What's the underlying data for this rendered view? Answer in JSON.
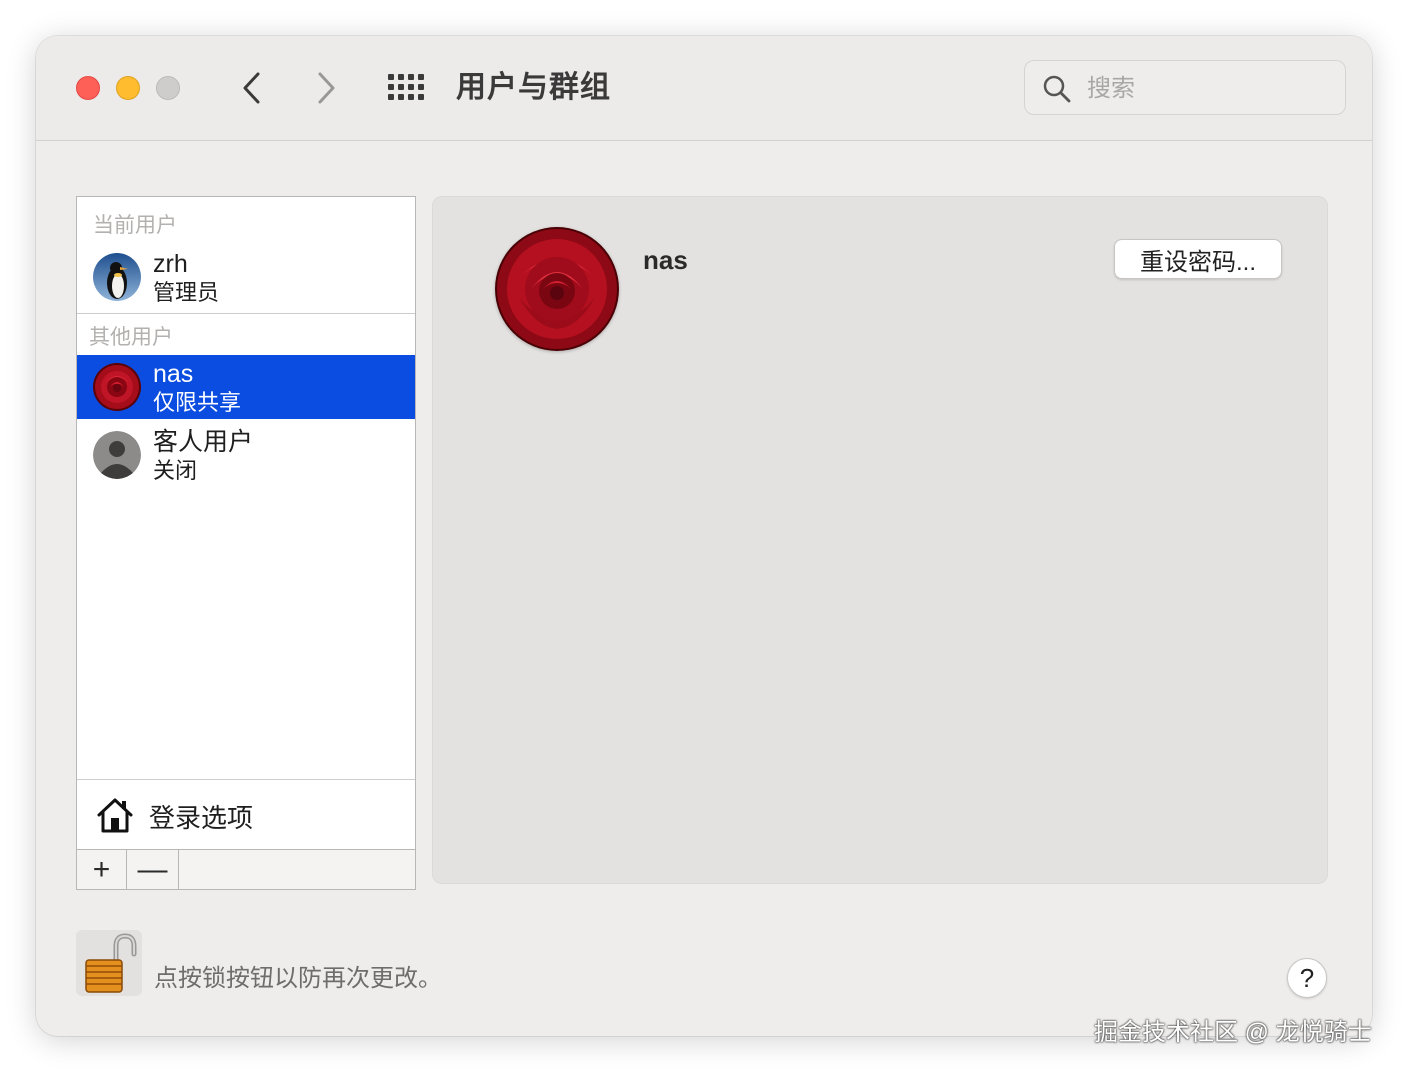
{
  "window": {
    "title": "用户与群组"
  },
  "toolbar": {
    "back_icon": "chevron-left-icon",
    "forward_icon": "chevron-right-icon",
    "grid_icon": "grid-icon"
  },
  "search": {
    "placeholder": "搜索",
    "value": ""
  },
  "sidebar": {
    "current_header": "当前用户",
    "other_header": "其他用户",
    "users": [
      {
        "name": "zrh",
        "role": "管理员",
        "avatar": "penguin-avatar"
      },
      {
        "name": "nas",
        "role": "仅限共享",
        "avatar": "rose-avatar",
        "selected": true
      },
      {
        "name": "客人用户",
        "role": "关闭",
        "avatar": "guest-avatar"
      }
    ],
    "login_options": "登录选项",
    "add_label": "+",
    "remove_label": "—"
  },
  "detail": {
    "name": "nas",
    "reset_password": "重设密码..."
  },
  "footer": {
    "lock_text": "点按锁按钮以防再次更改。",
    "help": "?"
  },
  "watermark": "掘金技术社区 @ 龙悦骑士",
  "colors": {
    "selection": "#0b4de0",
    "close": "#fe5f57",
    "minimize": "#febc2e"
  }
}
